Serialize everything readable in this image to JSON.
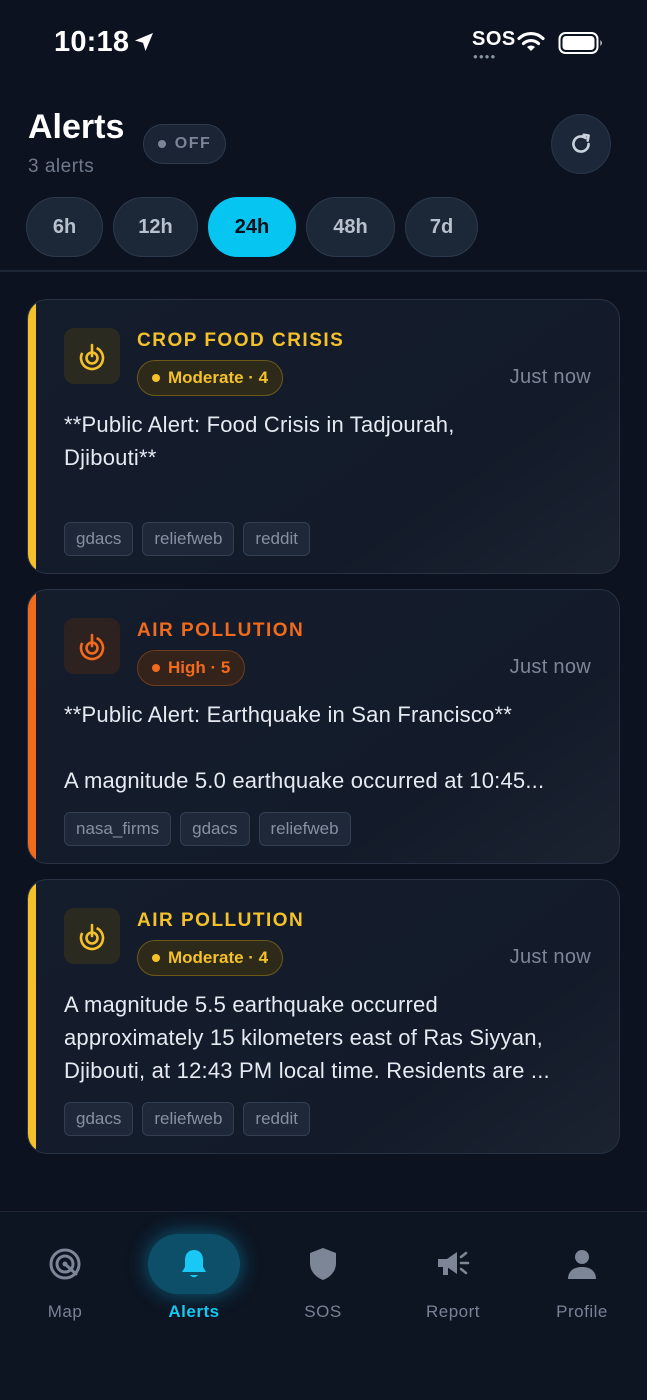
{
  "status_bar": {
    "time": "10:18",
    "sos": "SOS"
  },
  "header": {
    "title": "Alerts",
    "count": "3 alerts",
    "toggle_label": "OFF"
  },
  "filters": [
    "6h",
    "12h",
    "24h",
    "48h",
    "7d"
  ],
  "active_filter": "24h",
  "colors": {
    "accent": "#06c6f1",
    "moderate": "#f4c12a",
    "high": "#f26a1b",
    "background": "#0c1220"
  },
  "cards": [
    {
      "category": "CROP FOOD CRISIS",
      "severity": "Moderate · 4",
      "time": "Just now",
      "body": [
        "**Public Alert: Food Crisis in Tadjourah,",
        "Djibouti**"
      ],
      "tags": [
        "gdacs",
        "reliefweb",
        "reddit"
      ],
      "icon": "radar-icon"
    },
    {
      "category": "AIR POLLUTION",
      "severity": "High · 5",
      "time": "Just now",
      "body": [
        "**Public Alert: Earthquake in San Francisco**",
        "",
        "A magnitude 5.0 earthquake occurred at 10:45..."
      ],
      "tags": [
        "nasa_firms",
        "gdacs",
        "reliefweb"
      ],
      "icon": "radar-icon"
    },
    {
      "category": "AIR POLLUTION",
      "severity": "Moderate · 4",
      "time": "Just now",
      "body": [
        "A magnitude 5.5 earthquake occurred",
        "approximately 15 kilometers east of Ras Siyyan,",
        "Djibouti, at 12:43 PM local time. Residents are ..."
      ],
      "tags": [
        "gdacs",
        "reliefweb",
        "reddit"
      ],
      "icon": "radar-icon"
    }
  ],
  "nav": [
    {
      "label": "Map",
      "icon": "radar-icon"
    },
    {
      "label": "Alerts",
      "icon": "bell-icon"
    },
    {
      "label": "SOS",
      "icon": "shield-icon"
    },
    {
      "label": "Report",
      "icon": "megaphone-icon"
    },
    {
      "label": "Profile",
      "icon": "person-icon"
    }
  ],
  "active_nav": "Alerts"
}
